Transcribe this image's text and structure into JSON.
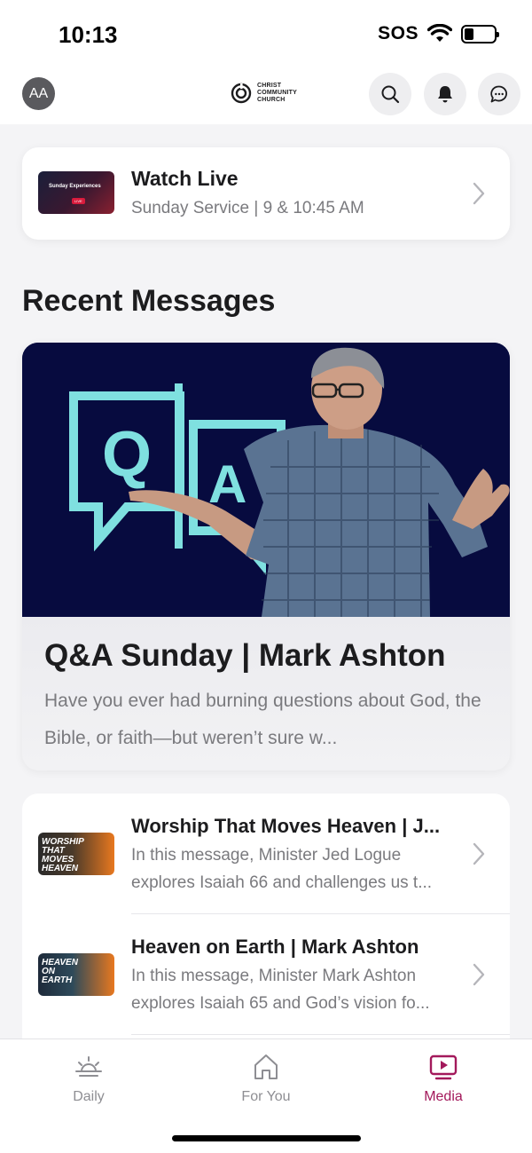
{
  "status_bar": {
    "time": "10:13",
    "sos": "SOS",
    "battery_level": 0.3
  },
  "header": {
    "avatar_initials": "AA",
    "brand_lines": [
      "CHRIST",
      "COMMUNITY",
      "CHURCH"
    ],
    "icons": [
      "search-icon",
      "bell-icon",
      "chat-icon"
    ]
  },
  "watch_live": {
    "title": "Watch Live",
    "subtitle": "Sunday Service | 9 & 10:45 AM",
    "thumb_text": "Sunday Experiences",
    "thumb_badge": "LIVE"
  },
  "recent_messages": {
    "heading": "Recent Messages",
    "featured": {
      "image_q": "Q",
      "image_a": "A",
      "title": "Q&A Sunday | Mark Ashton",
      "description": "Have you ever had burning questions about God, the Bible, or faith—but weren’t sure w..."
    },
    "items": [
      {
        "title": "Worship That Moves Heaven | J...",
        "description": "In this message, Minister Jed Logue explores Isaiah 66 and challenges us t...",
        "thumb_text": "WORSHIP THAT MOVES HEAVEN"
      },
      {
        "title": "Heaven on Earth | Mark Ashton",
        "description": "In this message, Minister Mark Ashton explores Isaiah 65 and God’s vision fo...",
        "thumb_text": "HEAVEN ON EARTH"
      }
    ]
  },
  "tabs": [
    {
      "label": "Daily",
      "icon": "sunrise-icon",
      "active": false
    },
    {
      "label": "For You",
      "icon": "home-icon",
      "active": false
    },
    {
      "label": "Media",
      "icon": "play-icon",
      "active": true
    }
  ],
  "colors": {
    "accent": "#a3195b",
    "inactive": "#8e8e93",
    "hero_bg": "#070b3f",
    "qa_teal": "#7fe0e0"
  }
}
